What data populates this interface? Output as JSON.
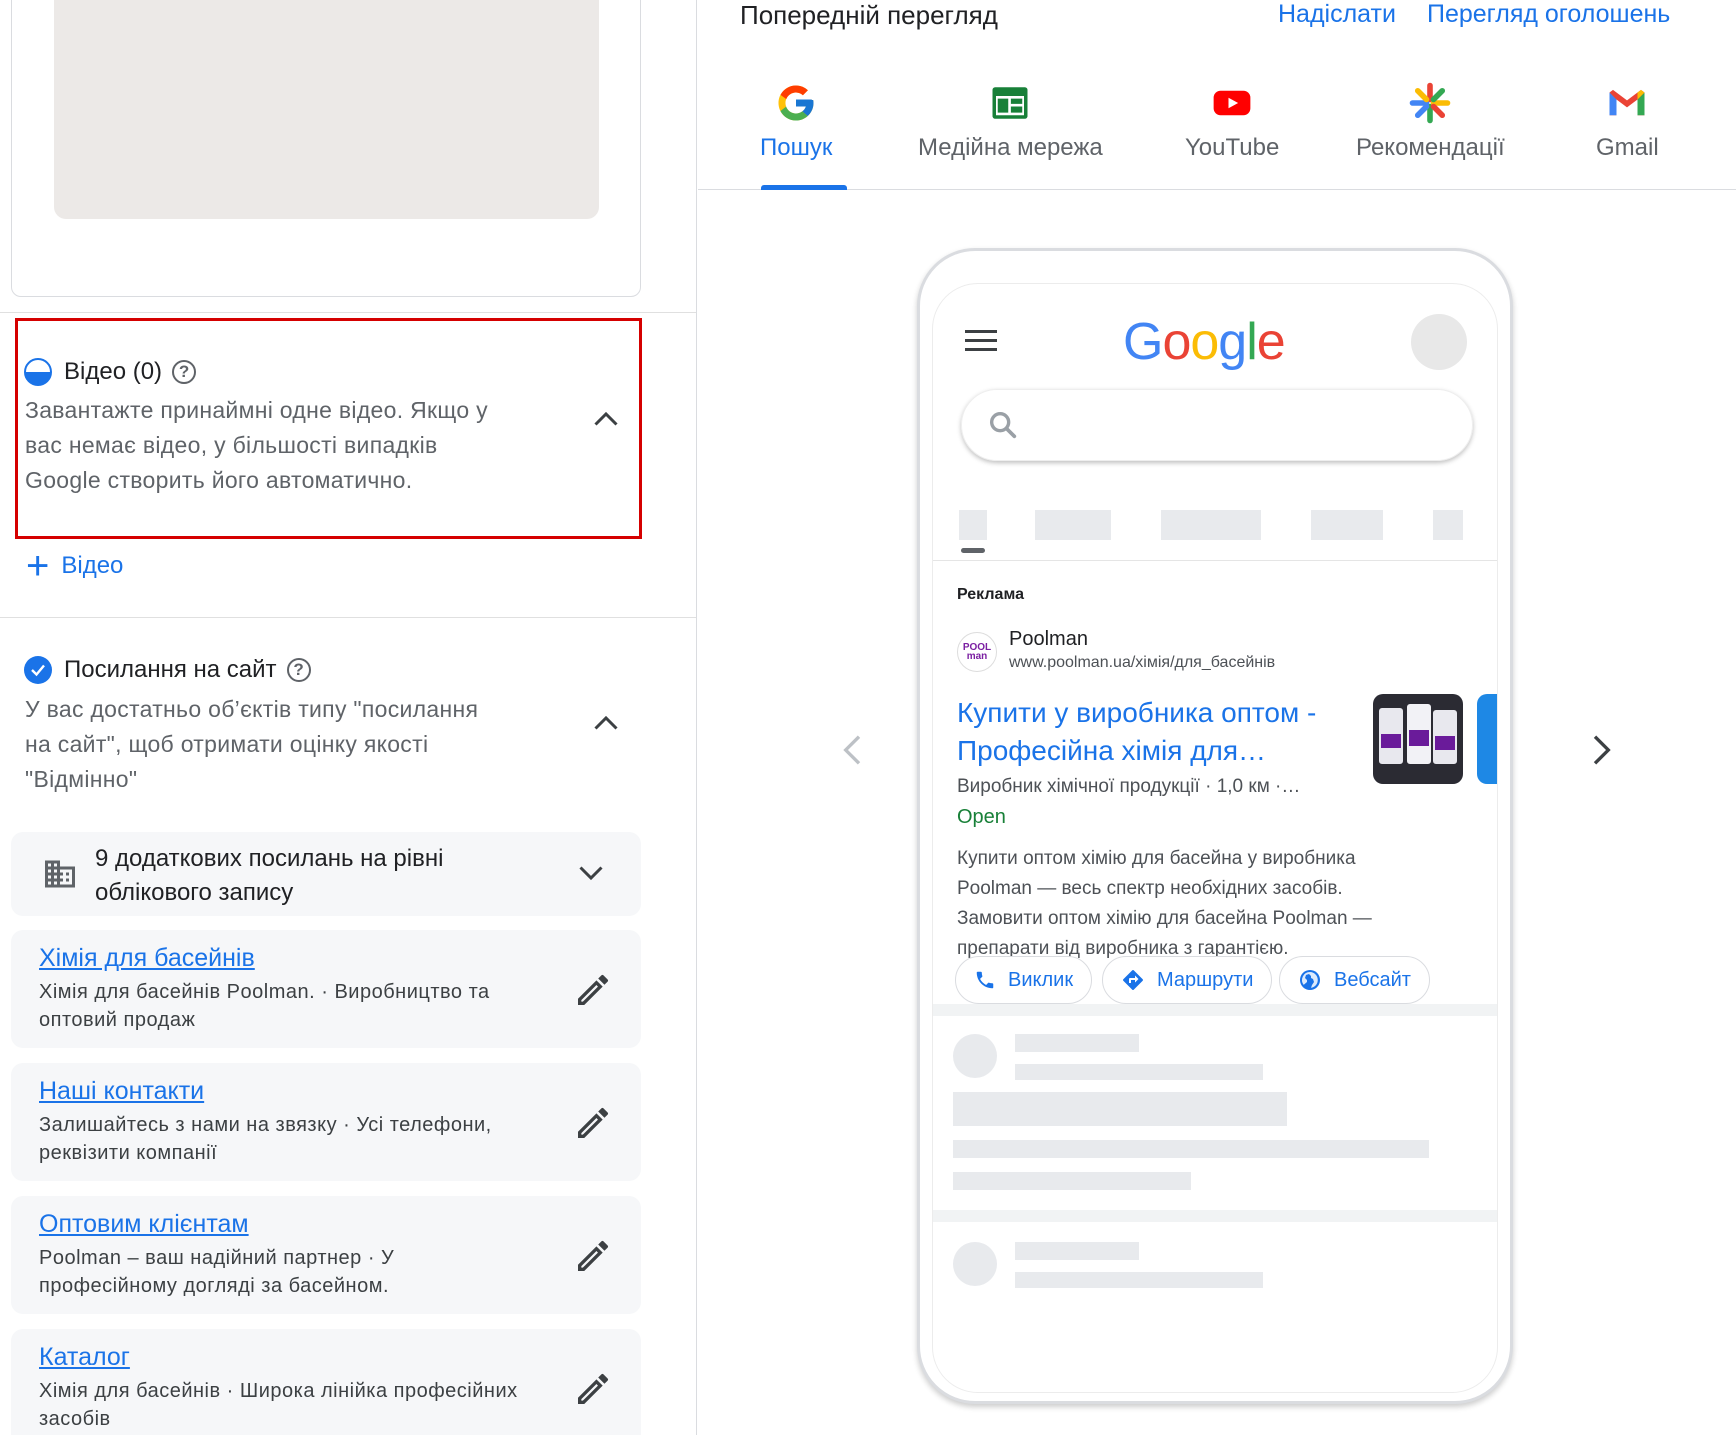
{
  "left": {
    "video_section": {
      "title": "Відео (0)",
      "description_lines": [
        "Завантажте принаймні одне відео. Якщо у",
        "вас немає відео, у більшості випадків",
        "Google створить його автоматично."
      ],
      "add_label": "Відео"
    },
    "sitelinks_section": {
      "title": "Посилання на сайт",
      "description_lines": [
        "У вас достатньо об’єктів типу \"посилання",
        "на сайт\", щоб отримати оцінку якості",
        "\"Відмінно\""
      ],
      "account_links_lines": [
        "9 додаткових посилань на рівні",
        "облікового запису"
      ],
      "items": [
        {
          "title": "Хімія для басейнів",
          "desc_lines": [
            "Хімія для басейнів Poolman. · Виробництво та",
            "оптовий продаж"
          ]
        },
        {
          "title": "Наші контакти",
          "desc_lines": [
            "Залишайтесь з нами на звязку · Усі телефони,",
            "реквізити компанії"
          ]
        },
        {
          "title": "Оптовим клієнтам",
          "desc_lines": [
            "Poolman – ваш надійний партнер · У",
            "професійному догляді за басейном."
          ]
        },
        {
          "title": "Каталог",
          "desc_lines": [
            "Хімія для басейнів · Широка лінійка професійних",
            "засобів"
          ]
        }
      ]
    }
  },
  "right": {
    "preview_title": "Попередній перегляд",
    "send_link": "Надіслати",
    "view_ads_link": "Перегляд оголошень",
    "tabs": [
      {
        "label": "Пошук",
        "icon": "google-g-icon",
        "active": true
      },
      {
        "label": "Медійна мережа",
        "icon": "display-network-icon",
        "active": false
      },
      {
        "label": "YouTube",
        "icon": "youtube-icon",
        "active": false
      },
      {
        "label": "Рекомендації",
        "icon": "discover-icon",
        "active": false
      },
      {
        "label": "Gmail",
        "icon": "gmail-icon",
        "active": false
      }
    ],
    "phone": {
      "logo_text": "Google",
      "ad": {
        "label": "Реклама",
        "advertiser": "Poolman",
        "url": "www.poolman.ua/хімія/для_басейнів",
        "headline_lines": [
          "Купити у виробника оптом -",
          "Професійна хімія для…"
        ],
        "meta": "Виробник хімічної продукції · 1,0 км ·…",
        "status": "Open",
        "description_lines": [
          "Купити оптом хімію для басейна у виробника",
          "Poolman — весь спектр необхідних засобів.",
          "Замовити оптом хімію для басейна Poolman —",
          "препарати від виробника з гарантією."
        ],
        "buttons": [
          "Виклик",
          "Маршрути",
          "Вебсайт"
        ]
      }
    }
  },
  "colors": {
    "accent": "#1a73e8",
    "error_outline": "#d50000",
    "open_green": "#188038"
  }
}
